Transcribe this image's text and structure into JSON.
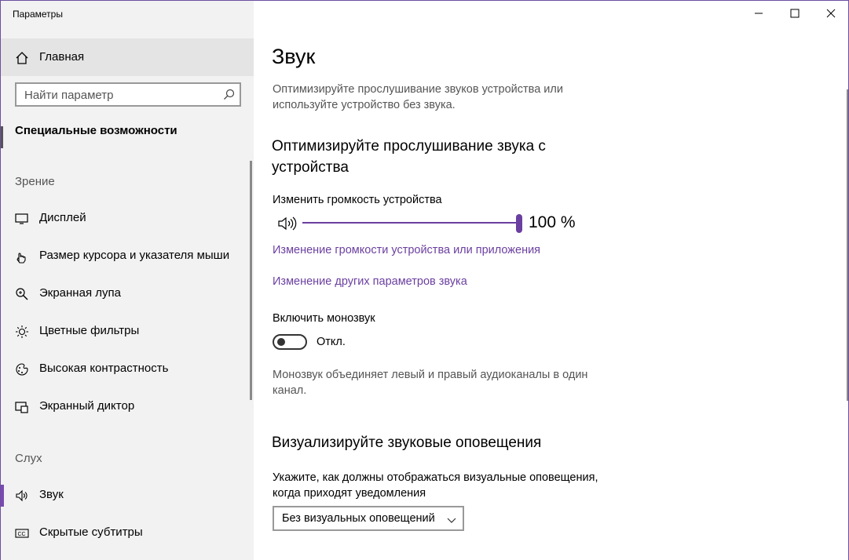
{
  "window": {
    "title": "Параметры"
  },
  "sidebar": {
    "home_label": "Главная",
    "search_placeholder": "Найти параметр",
    "section_title": "Специальные возможности",
    "groups": [
      {
        "label": "Зрение"
      },
      {
        "label": "Слух"
      }
    ],
    "items": [
      {
        "label": "Дисплей",
        "icon": "monitor-icon"
      },
      {
        "label": "Размер курсора и указателя мыши",
        "icon": "cursor-icon"
      },
      {
        "label": "Экранная лупа",
        "icon": "magnifier-icon"
      },
      {
        "label": "Цветные фильтры",
        "icon": "sun-icon"
      },
      {
        "label": "Высокая контрастность",
        "icon": "contrast-icon"
      },
      {
        "label": "Экранный диктор",
        "icon": "narrator-icon"
      },
      {
        "label": "Звук",
        "icon": "speaker-icon",
        "active": true
      },
      {
        "label": "Скрытые субтитры",
        "icon": "cc-icon"
      }
    ]
  },
  "main": {
    "title": "Звук",
    "description": "Оптимизируйте прослушивание звуков устройства или используйте устройство без звука.",
    "section1_title": "Оптимизируйте прослушивание звука с устройства",
    "volume_label": "Изменить громкость устройства",
    "volume_value": "100 %",
    "volume_level": 1.0,
    "link1": "Изменение громкости устройства или приложения",
    "link2": "Изменение других параметров звука",
    "mono_label": "Включить монозвук",
    "mono_state": "Откл.",
    "mono_hint": "Монозвук объединяет левый и правый аудиоканалы в один канал.",
    "section2_title": "Визуализируйте звуковые оповещения",
    "visual_label": "Укажите, как должны отображаться визуальные оповещения, когда приходят уведомления",
    "visual_select_value": "Без визуальных оповещений"
  },
  "colors": {
    "accent": "#6b3fa0",
    "sidebar_bg": "#f2f2f2",
    "home_bg": "#e4e4e4"
  }
}
